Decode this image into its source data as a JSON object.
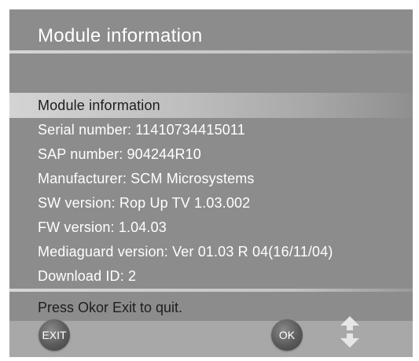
{
  "window": {
    "title": "Module information"
  },
  "module_info": {
    "rows": [
      "Module information",
      "Serial number: 11410734415011",
      "SAP number: 904244R10",
      "Manufacturer: SCM Microsystems",
      "SW version: Rop Up TV 1.03.002",
      "FW version: 1.04.03",
      "Mediaguard version: Ver 01.03 R 04(16/11/04)",
      "Download ID: 2"
    ],
    "selected_index": 0
  },
  "footer": {
    "hint": "Press Okor Exit to quit.",
    "exit_label": "EXIT",
    "ok_label": "OK",
    "arrows_icon": "up-down-arrows-icon"
  },
  "colors": {
    "panel": "#8c8c8c",
    "footer": "#a8a8a8",
    "button": "#5a5a5a",
    "text_light": "#ffffff",
    "text_dark": "#1e1e1e"
  }
}
